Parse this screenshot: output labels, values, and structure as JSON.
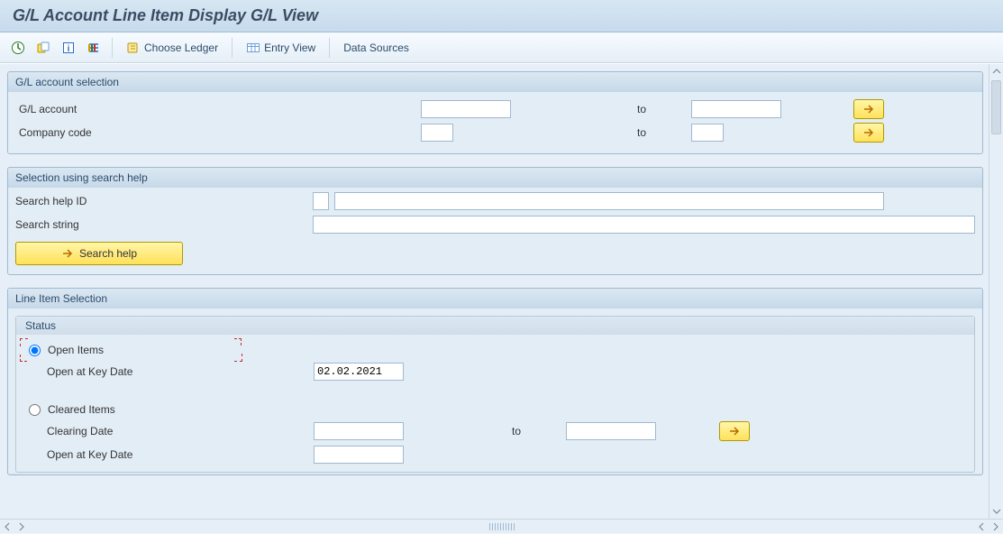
{
  "titlebar": {
    "title": "G/L Account Line Item Display G/L View"
  },
  "toolbar": {
    "choose_ledger": "Choose Ledger",
    "entry_view": "Entry View",
    "data_sources": "Data Sources"
  },
  "groups": {
    "account": {
      "title": "G/L account selection",
      "rows": {
        "gl_account": {
          "label": "G/L account",
          "to": "to",
          "value_from": "",
          "value_to": ""
        },
        "company_code": {
          "label": "Company code",
          "to": "to",
          "value_from": "",
          "value_to": ""
        }
      }
    },
    "searchhelp": {
      "title": "Selection using search help",
      "rows": {
        "help_id": {
          "label": "Search help ID",
          "btn_value": "",
          "value": ""
        },
        "search_string": {
          "label": "Search string",
          "value": ""
        },
        "btn": "Search help"
      }
    },
    "lineitem": {
      "title": "Line Item Selection",
      "status": {
        "title": "Status",
        "open_items": "Open Items",
        "open_key_date_label": "Open at Key Date",
        "open_key_date_value": "02.02.2021",
        "cleared_items": "Cleared Items",
        "clearing_date_label": "Clearing Date",
        "clearing_date_to": "to",
        "clearing_date_from_value": "",
        "clearing_date_to_value": "",
        "cleared_open_key_date_label": "Open at Key Date",
        "cleared_open_key_date_value": ""
      }
    }
  }
}
